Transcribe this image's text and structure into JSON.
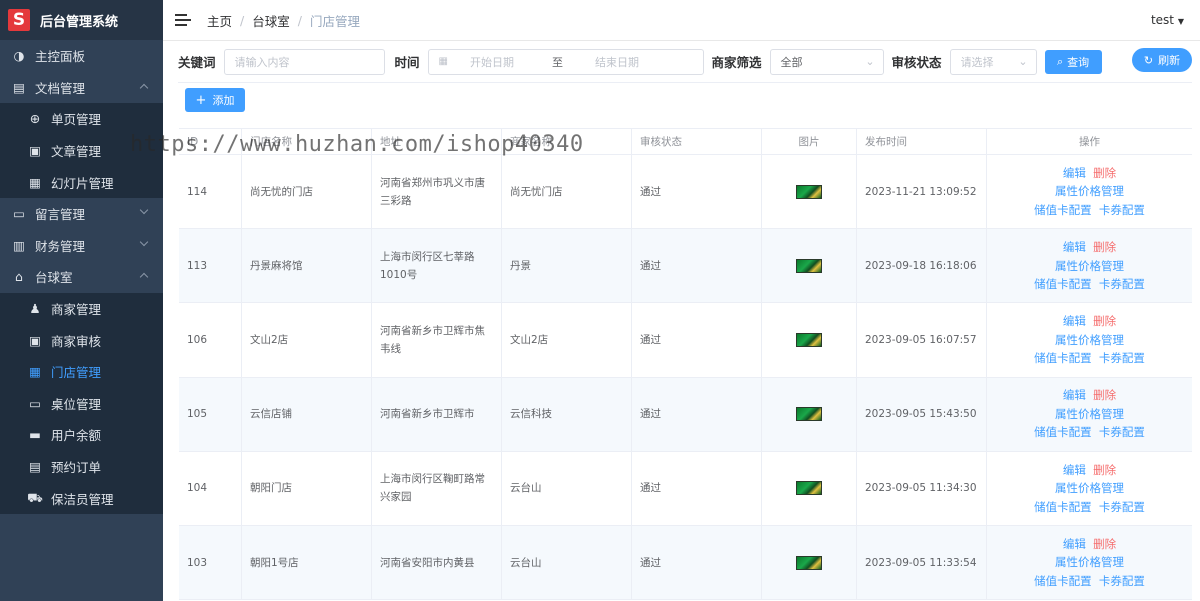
{
  "app": {
    "title": "后台管理系统",
    "logo_letter": "S"
  },
  "sidebar": {
    "items": [
      {
        "label": "主控面板",
        "icon": "dashboard-icon"
      },
      {
        "label": "文档管理",
        "icon": "document-icon",
        "expanded": true
      },
      {
        "label": "单页管理",
        "icon": "plus-circle-icon",
        "sub": true
      },
      {
        "label": "文章管理",
        "icon": "article-icon",
        "sub": true
      },
      {
        "label": "幻灯片管理",
        "icon": "grid-icon",
        "sub": true
      },
      {
        "label": "留言管理",
        "icon": "message-icon",
        "expanded": false
      },
      {
        "label": "财务管理",
        "icon": "finance-icon",
        "expanded": false
      },
      {
        "label": "台球室",
        "icon": "home-icon",
        "expanded": true
      },
      {
        "label": "商家管理",
        "icon": "user-icon",
        "sub": true
      },
      {
        "label": "商家审核",
        "icon": "audit-icon",
        "sub": true
      },
      {
        "label": "门店管理",
        "icon": "grid-icon",
        "sub": true,
        "active": true
      },
      {
        "label": "桌位管理",
        "icon": "table-icon",
        "sub": true
      },
      {
        "label": "用户余额",
        "icon": "folder-icon",
        "sub": true
      },
      {
        "label": "预约订单",
        "icon": "order-icon",
        "sub": true
      },
      {
        "label": "保洁员管理",
        "icon": "cart-icon",
        "sub": true
      }
    ]
  },
  "header": {
    "breadcrumb": [
      "主页",
      "台球室",
      "门店管理"
    ],
    "user": "test"
  },
  "filter": {
    "keyword_label": "关键词",
    "keyword_placeholder": "请输入内容",
    "time_label": "时间",
    "start_placeholder": "开始日期",
    "range_sep": "至",
    "end_placeholder": "结束日期",
    "merchant_label": "商家筛选",
    "merchant_value": "全部",
    "status_label": "审核状态",
    "status_placeholder": "请选择",
    "search_button": "查询",
    "refresh_button": "刷新",
    "add_button": "添加"
  },
  "table": {
    "headers": [
      "ID",
      "门店名称",
      "地址",
      "商家名称",
      "审核状态",
      "图片",
      "发布时间",
      "操作"
    ],
    "actions": {
      "edit": "编辑",
      "delete": "删除",
      "price": "属性价格管理",
      "card": "储值卡配置",
      "coupon": "卡券配置"
    },
    "rows": [
      {
        "id": "114",
        "name": "尚无忧的门店",
        "address": "河南省郑州市巩义市唐三彩路",
        "merchant": "尚无忧门店",
        "status": "通过",
        "time": "2023-11-21 13:09:52"
      },
      {
        "id": "113",
        "name": "丹景麻将馆",
        "address": "上海市闵行区七莘路1010号",
        "merchant": "丹景",
        "status": "通过",
        "time": "2023-09-18 16:18:06"
      },
      {
        "id": "106",
        "name": "文山2店",
        "address": "河南省新乡市卫辉市焦韦线",
        "merchant": "文山2店",
        "status": "通过",
        "time": "2023-09-05 16:07:57"
      },
      {
        "id": "105",
        "name": "云信店铺",
        "address": "河南省新乡市卫辉市",
        "merchant": "云信科技",
        "status": "通过",
        "time": "2023-09-05 15:43:50"
      },
      {
        "id": "104",
        "name": "朝阳门店",
        "address": "上海市闵行区鞠町路常兴家园",
        "merchant": "云台山",
        "status": "通过",
        "time": "2023-09-05 11:34:30"
      },
      {
        "id": "103",
        "name": "朝阳1号店",
        "address": "河南省安阳市内黄县",
        "merchant": "云台山",
        "status": "通过",
        "time": "2023-09-05 11:33:54"
      }
    ]
  },
  "watermark": "https://www.huzhan.com/ishop40340",
  "colors": {
    "sidebar": "#304156",
    "accent": "#409eff",
    "danger": "#f56c6c"
  }
}
